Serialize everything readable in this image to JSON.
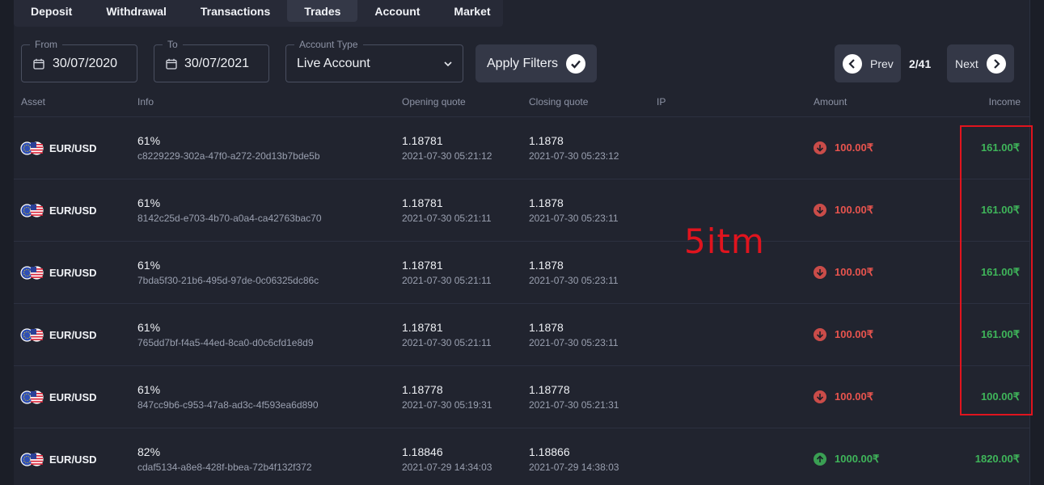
{
  "tabs": [
    {
      "label": "Deposit",
      "active": false
    },
    {
      "label": "Withdrawal",
      "active": false
    },
    {
      "label": "Transactions",
      "active": false
    },
    {
      "label": "Trades",
      "active": true
    },
    {
      "label": "Account",
      "active": false
    },
    {
      "label": "Market",
      "active": false
    }
  ],
  "filters": {
    "from": {
      "legend": "From",
      "value": "30/07/2020",
      "icon": "calendar-icon"
    },
    "to": {
      "legend": "To",
      "value": "30/07/2021",
      "icon": "calendar-icon"
    },
    "account_type": {
      "legend": "Account Type",
      "value": "Live Account",
      "icon": "chevron-down-icon"
    },
    "apply_label": "Apply Filters"
  },
  "pager": {
    "prev_label": "Prev",
    "next_label": "Next",
    "page": "2/41"
  },
  "columns": {
    "asset": "Asset",
    "info": "Info",
    "opening": "Opening quote",
    "closing": "Closing quote",
    "ip": "IP",
    "amount": "Amount",
    "income": "Income"
  },
  "rows": [
    {
      "asset": "EUR/USD",
      "pct": "61%",
      "id": "c8229229-302a-47f0-a272-20d13b7bde5b",
      "open_q": "1.18781",
      "open_t": "2021-07-30 05:21:12",
      "close_q": "1.1878",
      "close_t": "2021-07-30 05:23:12",
      "amount": "100.00₹",
      "direction": "down",
      "income": "161.00₹"
    },
    {
      "asset": "EUR/USD",
      "pct": "61%",
      "id": "8142c25d-e703-4b70-a0a4-ca42763bac70",
      "open_q": "1.18781",
      "open_t": "2021-07-30 05:21:11",
      "close_q": "1.1878",
      "close_t": "2021-07-30 05:23:11",
      "amount": "100.00₹",
      "direction": "down",
      "income": "161.00₹"
    },
    {
      "asset": "EUR/USD",
      "pct": "61%",
      "id": "7bda5f30-21b6-495d-97de-0c06325dc86c",
      "open_q": "1.18781",
      "open_t": "2021-07-30 05:21:11",
      "close_q": "1.1878",
      "close_t": "2021-07-30 05:23:11",
      "amount": "100.00₹",
      "direction": "down",
      "income": "161.00₹"
    },
    {
      "asset": "EUR/USD",
      "pct": "61%",
      "id": "765dd7bf-f4a5-44ed-8ca0-d0c6cfd1e8d9",
      "open_q": "1.18781",
      "open_t": "2021-07-30 05:21:11",
      "close_q": "1.1878",
      "close_t": "2021-07-30 05:23:11",
      "amount": "100.00₹",
      "direction": "down",
      "income": "161.00₹"
    },
    {
      "asset": "EUR/USD",
      "pct": "61%",
      "id": "847cc9b6-c953-47a8-ad3c-4f593ea6d890",
      "open_q": "1.18778",
      "open_t": "2021-07-30 05:19:31",
      "close_q": "1.18778",
      "close_t": "2021-07-30 05:21:31",
      "amount": "100.00₹",
      "direction": "down",
      "income": "100.00₹"
    },
    {
      "asset": "EUR/USD",
      "pct": "82%",
      "id": "cdaf5134-a8e8-428f-bbea-72b4f132f372",
      "open_q": "1.18846",
      "open_t": "2021-07-29 14:34:03",
      "close_q": "1.18866",
      "close_t": "2021-07-29 14:38:03",
      "amount": "1000.00₹",
      "direction": "up",
      "income": "1820.00₹"
    }
  ],
  "annotation": "5itm",
  "colors": {
    "down": "#e8544e",
    "up": "#3fb55a",
    "income": "#3fb55a",
    "annotation": "#e0141e"
  }
}
